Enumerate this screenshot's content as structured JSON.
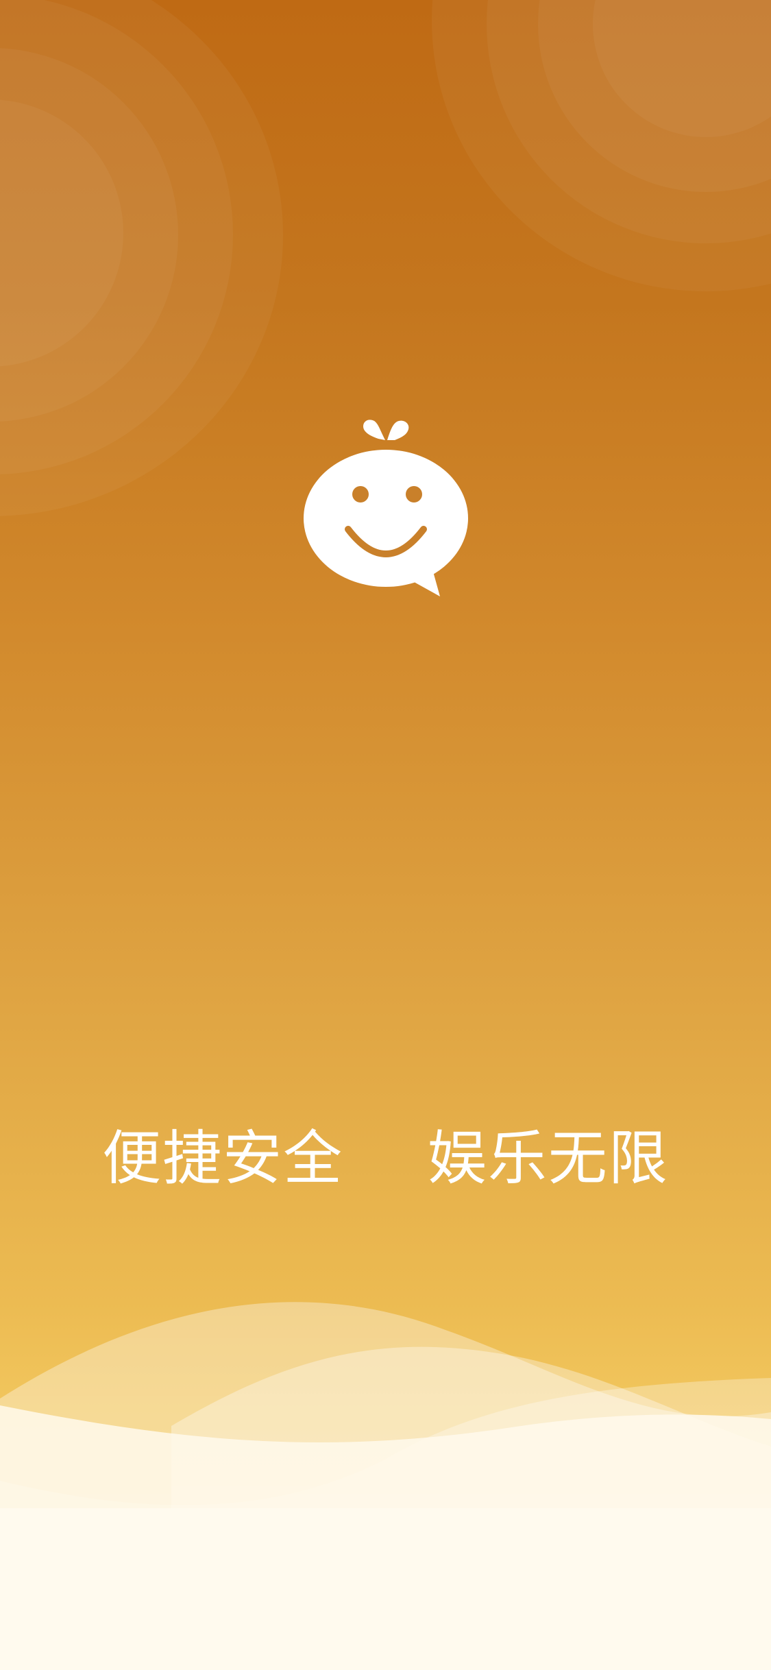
{
  "splash": {
    "tagline": "便捷安全  娱乐无限",
    "logo_icon": "smiling-chat-bubble-icon"
  },
  "colors": {
    "gradient_top": "#bf6a14",
    "gradient_middle": "#dea241",
    "gradient_bottom": "#f2c75e",
    "logo": "#ffffff",
    "tagline": "#ffffff",
    "wave_fill": "#fff9ec"
  }
}
